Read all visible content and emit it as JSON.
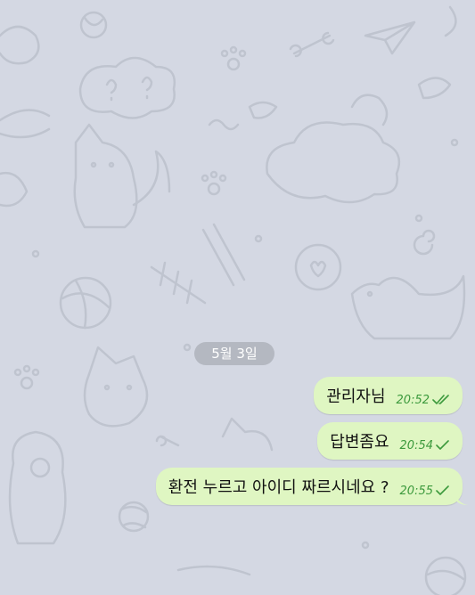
{
  "chat": {
    "date_divider": "5월 3일",
    "messages": [
      {
        "text": "관리자님",
        "time": "20:52",
        "status": "read",
        "status_icon": "double-check-icon"
      },
      {
        "text": "답변좀요",
        "time": "20:54",
        "status": "sent",
        "status_icon": "check-icon"
      },
      {
        "text": "환전 누르고 아이디 짜르시네요 ?",
        "time": "20:55",
        "status": "sent",
        "status_icon": "check-icon"
      }
    ]
  },
  "colors": {
    "wallpaper": "#d4d8e3",
    "doodle": "#bfc4cf",
    "outgoing_bubble": "#dff6c2",
    "time_text": "#3d9a3d",
    "date_pill": "#b4b8c1"
  }
}
